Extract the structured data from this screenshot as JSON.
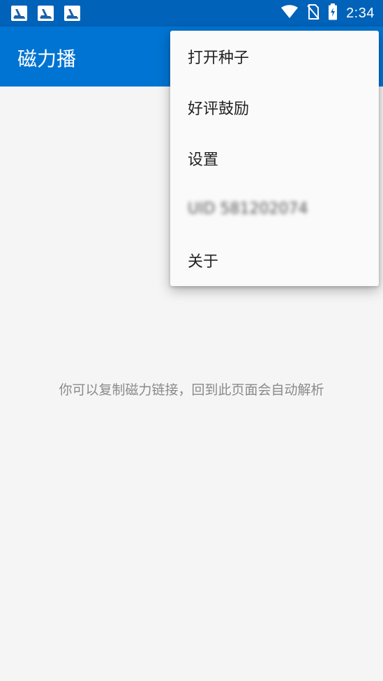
{
  "status_bar": {
    "time": "2:34",
    "notification_icons": [
      "app-notification-icon",
      "app-notification-icon",
      "app-notification-icon"
    ],
    "system_icons": [
      "wifi-icon",
      "no-sim-icon",
      "battery-charging-icon"
    ]
  },
  "app_bar": {
    "title": "磁力播"
  },
  "menu": {
    "items": [
      {
        "label": "打开种子"
      },
      {
        "label": "好评鼓励"
      },
      {
        "label": "设置"
      },
      {
        "label": "UID 581202074"
      },
      {
        "label": "关于"
      }
    ]
  },
  "main": {
    "hint": "你可以复制磁力链接，回到此页面会自动解析"
  },
  "colors": {
    "status_bar": "#0062b8",
    "app_bar": "#0074d2",
    "background": "#f5f5f5",
    "menu_background": "#fafafa"
  }
}
